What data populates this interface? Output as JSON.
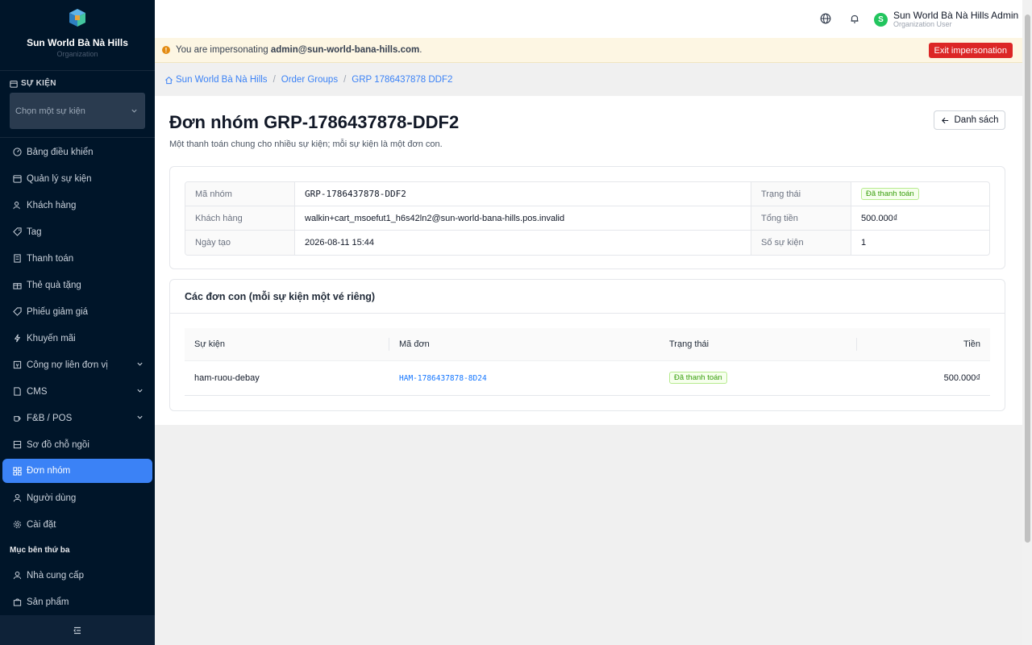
{
  "brand": {
    "name": "Sun World Bà Nà Hills",
    "subtitle": "Organization"
  },
  "event_selector": {
    "section_label": "SỰ KIỆN",
    "placeholder": "Chọn một sự kiện"
  },
  "sidebar": {
    "items": [
      {
        "label": "Bảng điều khiển",
        "icon": "dashboard-icon"
      },
      {
        "label": "Quản lý sự kiện",
        "icon": "calendar-icon"
      },
      {
        "label": "Khách hàng",
        "icon": "users-icon"
      },
      {
        "label": "Tag",
        "icon": "tag-icon"
      },
      {
        "label": "Thanh toán",
        "icon": "receipt-icon"
      },
      {
        "label": "Thẻ quà tặng",
        "icon": "gift-icon"
      },
      {
        "label": "Phiếu giảm giá",
        "icon": "coupon-icon"
      },
      {
        "label": "Khuyến mãi",
        "icon": "flash-icon"
      },
      {
        "label": "Công nợ liên đơn vị",
        "icon": "ledger-icon"
      },
      {
        "label": "CMS",
        "icon": "file-icon"
      },
      {
        "label": "F&B / POS",
        "icon": "coffee-icon"
      },
      {
        "label": "Sơ đồ chỗ ngồi",
        "icon": "seat-map-icon"
      },
      {
        "label": "Đơn nhóm",
        "icon": "grid-icon"
      },
      {
        "label": "Người dùng",
        "icon": "user-icon"
      },
      {
        "label": "Cài đặt",
        "icon": "gear-icon"
      }
    ],
    "group_label": "Mục bên thứ ba",
    "third_party": [
      {
        "label": "Nhà cung cấp",
        "icon": "user-icon"
      },
      {
        "label": "Sản phẩm",
        "icon": "bag-icon"
      }
    ]
  },
  "header": {
    "user_name": "Sun World Bà Nà Hills Admin",
    "user_role": "Organization User",
    "avatar_letter": "S"
  },
  "banner": {
    "prefix": "You are impersonating",
    "email": "admin@sun-world-bana-hills.com",
    "suffix": ".",
    "exit_label": "Exit impersonation"
  },
  "breadcrumb": {
    "home": "Sun World Bà Nà Hills",
    "section": "Order Groups",
    "current": "GRP 1786437878 DDF2"
  },
  "page": {
    "title": "Đơn nhóm GRP-1786437878-DDF2",
    "subtitle": "Một thanh toán chung cho nhiều sự kiện; mỗi sự kiện là một đơn con.",
    "back_label": "Danh sách"
  },
  "info": {
    "group_code_label": "Mã nhóm",
    "group_code": "GRP-1786437878-DDF2",
    "status_label": "Trạng thái",
    "status": "Đã thanh toán",
    "customer_label": "Khách hàng",
    "customer": "walkin+cart_msoefut1_h6s42ln2@sun-world-bana-hills.pos.invalid",
    "total_label": "Tổng tiền",
    "total": "500.000₫",
    "created_label": "Ngày tạo",
    "created": "2026-08-11 15:44",
    "event_count_label": "Số sự kiện",
    "event_count": "1"
  },
  "child_orders": {
    "title": "Các đơn con (mỗi sự kiện một vé riêng)",
    "columns": [
      "Sự kiện",
      "Mã đơn",
      "Trạng thái",
      "Tiền"
    ],
    "rows": [
      {
        "event": "ham-ruou-debay",
        "code": "HAM-1786437878-8D24",
        "status": "Đã thanh toán",
        "amount": "500.000₫"
      }
    ]
  },
  "colors": {
    "sidebar_bg": "#001529",
    "accent": "#3b82f6",
    "danger": "#dc2626",
    "success": "#389e0d"
  }
}
